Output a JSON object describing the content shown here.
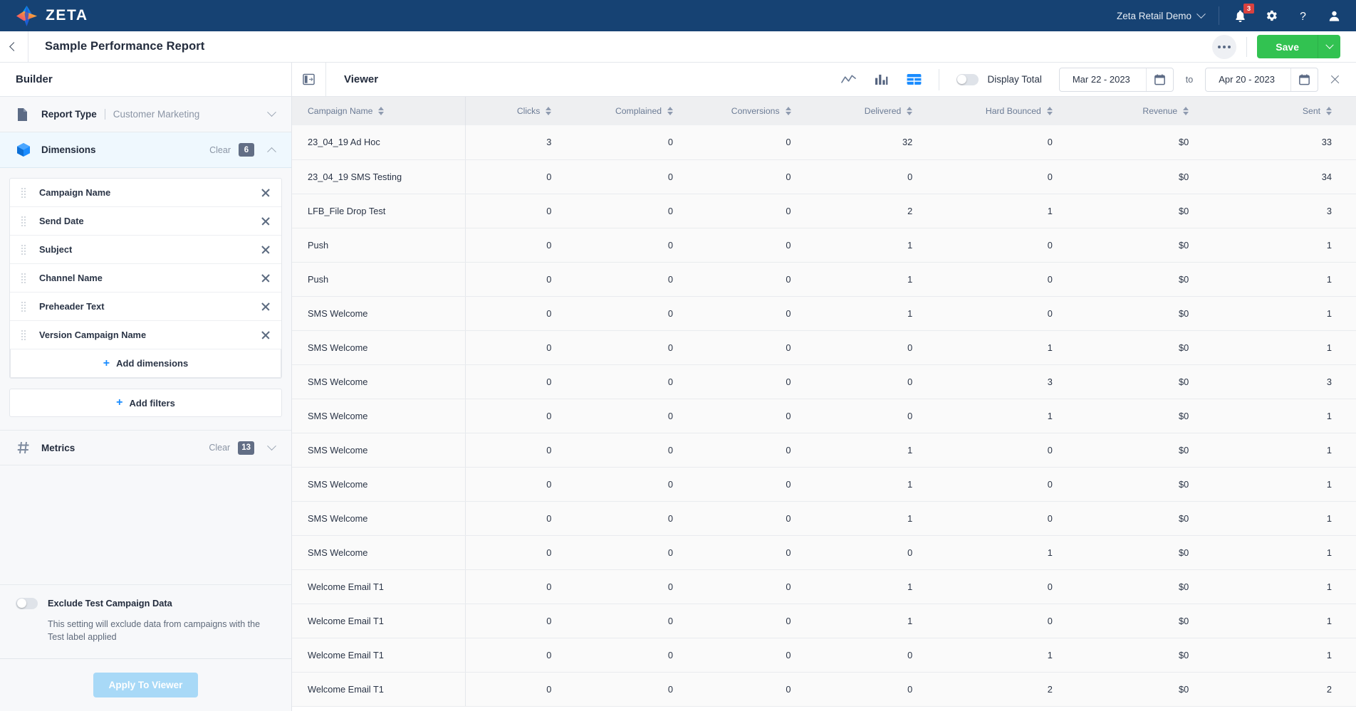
{
  "topnav": {
    "brand": "ZETA",
    "account": "Zeta Retail Demo",
    "notification_count": "3"
  },
  "subheader": {
    "title": "Sample Performance Report",
    "save_label": "Save"
  },
  "sidebar": {
    "heading": "Builder",
    "report_type": {
      "label": "Report Type",
      "value": "Customer Marketing"
    },
    "dimensions": {
      "label": "Dimensions",
      "clear_label": "Clear",
      "count": "6",
      "items": [
        {
          "name": "Campaign Name"
        },
        {
          "name": "Send Date"
        },
        {
          "name": "Subject"
        },
        {
          "name": "Channel Name"
        },
        {
          "name": "Preheader Text"
        },
        {
          "name": "Version Campaign Name"
        }
      ],
      "add_dimensions_label": "Add dimensions",
      "add_filters_label": "Add filters"
    },
    "metrics": {
      "label": "Metrics",
      "clear_label": "Clear",
      "count": "13"
    },
    "exclude": {
      "label": "Exclude Test Campaign Data",
      "description": "This setting will exclude data from campaigns with the Test label applied",
      "enabled": false
    },
    "apply_label": "Apply To Viewer"
  },
  "viewer": {
    "title": "Viewer",
    "display_total_label": "Display Total",
    "display_total_on": false,
    "date_from": "Mar 22 - 2023",
    "date_to_label": "to",
    "date_to": "Apr 20 - 2023",
    "active_view": "table",
    "accent_color": "#1a8cff",
    "save_color": "#32c251",
    "brand_color": "#164273"
  },
  "table": {
    "columns": [
      "Campaign Name",
      "Clicks",
      "Complained",
      "Conversions",
      "Delivered",
      "Hard Bounced",
      "Revenue",
      "Sent"
    ],
    "rows": [
      [
        "23_04_19 Ad Hoc",
        "3",
        "0",
        "0",
        "32",
        "0",
        "$0",
        "33"
      ],
      [
        "23_04_19 SMS Testing",
        "0",
        "0",
        "0",
        "0",
        "0",
        "$0",
        "34"
      ],
      [
        "LFB_File Drop Test",
        "0",
        "0",
        "0",
        "2",
        "1",
        "$0",
        "3"
      ],
      [
        "Push",
        "0",
        "0",
        "0",
        "1",
        "0",
        "$0",
        "1"
      ],
      [
        "Push",
        "0",
        "0",
        "0",
        "1",
        "0",
        "$0",
        "1"
      ],
      [
        "SMS Welcome",
        "0",
        "0",
        "0",
        "1",
        "0",
        "$0",
        "1"
      ],
      [
        "SMS Welcome",
        "0",
        "0",
        "0",
        "0",
        "1",
        "$0",
        "1"
      ],
      [
        "SMS Welcome",
        "0",
        "0",
        "0",
        "0",
        "3",
        "$0",
        "3"
      ],
      [
        "SMS Welcome",
        "0",
        "0",
        "0",
        "0",
        "1",
        "$0",
        "1"
      ],
      [
        "SMS Welcome",
        "0",
        "0",
        "0",
        "1",
        "0",
        "$0",
        "1"
      ],
      [
        "SMS Welcome",
        "0",
        "0",
        "0",
        "1",
        "0",
        "$0",
        "1"
      ],
      [
        "SMS Welcome",
        "0",
        "0",
        "0",
        "1",
        "0",
        "$0",
        "1"
      ],
      [
        "SMS Welcome",
        "0",
        "0",
        "0",
        "0",
        "1",
        "$0",
        "1"
      ],
      [
        "Welcome Email T1",
        "0",
        "0",
        "0",
        "1",
        "0",
        "$0",
        "1"
      ],
      [
        "Welcome Email T1",
        "0",
        "0",
        "0",
        "1",
        "0",
        "$0",
        "1"
      ],
      [
        "Welcome Email T1",
        "0",
        "0",
        "0",
        "0",
        "1",
        "$0",
        "1"
      ],
      [
        "Welcome Email T1",
        "0",
        "0",
        "0",
        "0",
        "2",
        "$0",
        "2"
      ]
    ]
  }
}
